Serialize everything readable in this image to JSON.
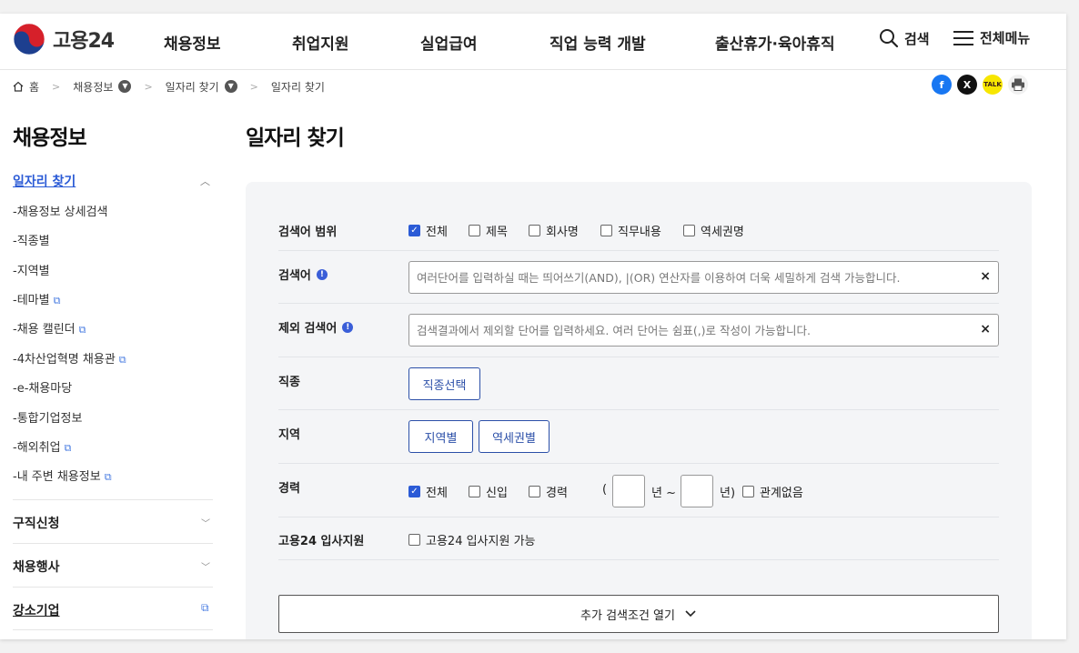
{
  "header": {
    "logo_text": "고용24",
    "nav": [
      "채용정보",
      "취업지원",
      "실업급여",
      "직업 능력 개발",
      "출산휴가·육아휴직"
    ],
    "search_label": "검색",
    "menu_label": "전체메뉴"
  },
  "breadcrumb": {
    "home": "홈",
    "level1": "채용정보",
    "level2": "일자리 찾기",
    "level3": "일자리 찾기"
  },
  "share": {
    "facebook": "f",
    "x": "X",
    "kakao": "TALK"
  },
  "sidebar": {
    "title": "채용정보",
    "active": "일자리 찾기",
    "sub_items": [
      {
        "label": "-채용정보 상세검색",
        "external": false
      },
      {
        "label": "-직종별",
        "external": false
      },
      {
        "label": "-지역별",
        "external": false
      },
      {
        "label": "-테마별",
        "external": true
      },
      {
        "label": "-채용 캘린더",
        "external": true
      },
      {
        "label": "-4차산업혁명 채용관",
        "external": true
      },
      {
        "label": "-e-채용마당",
        "external": false
      },
      {
        "label": "-통합기업정보",
        "external": false
      },
      {
        "label": "-해외취업",
        "external": true
      },
      {
        "label": "-내 주변 채용정보",
        "external": true
      }
    ],
    "groups": [
      "구직신청",
      "채용행사",
      "강소기업"
    ]
  },
  "main": {
    "title": "일자리 찾기",
    "scope": {
      "label": "검색어 범위",
      "options": [
        {
          "label": "전체",
          "checked": true
        },
        {
          "label": "제목",
          "checked": false
        },
        {
          "label": "회사명",
          "checked": false
        },
        {
          "label": "직무내용",
          "checked": false
        },
        {
          "label": "역세권명",
          "checked": false
        }
      ]
    },
    "keyword": {
      "label": "검색어",
      "placeholder": "여러단어를 입력하실 때는 띄어쓰기(AND), |(OR) 연산자를 이용하여 더욱 세밀하게 검색 가능합니다."
    },
    "exclude": {
      "label": "제외 검색어",
      "placeholder": "검색결과에서 제외할 단어를 입력하세요. 여러 단어는 쉼표(,)로 작성이 가능합니다."
    },
    "job": {
      "label": "직종",
      "button": "직종선택"
    },
    "region": {
      "label": "지역",
      "buttons": [
        "지역별",
        "역세권별"
      ]
    },
    "career": {
      "label": "경력",
      "options": [
        {
          "label": "전체",
          "checked": true
        },
        {
          "label": "신입",
          "checked": false
        },
        {
          "label": "경력",
          "checked": false
        }
      ],
      "open_paren": "(",
      "from_unit": "년 ~",
      "to_unit": "년)",
      "any": {
        "label": "관계없음",
        "checked": false
      }
    },
    "support": {
      "label": "고용24 입사지원",
      "option": {
        "label": "고용24 입사지원 가능",
        "checked": false
      }
    },
    "more_button": "추가 검색조건 열기"
  },
  "colors": {
    "accent": "#2b5bd6",
    "button_border": "#2b4fa8",
    "panel_bg": "#f4f5f7"
  }
}
